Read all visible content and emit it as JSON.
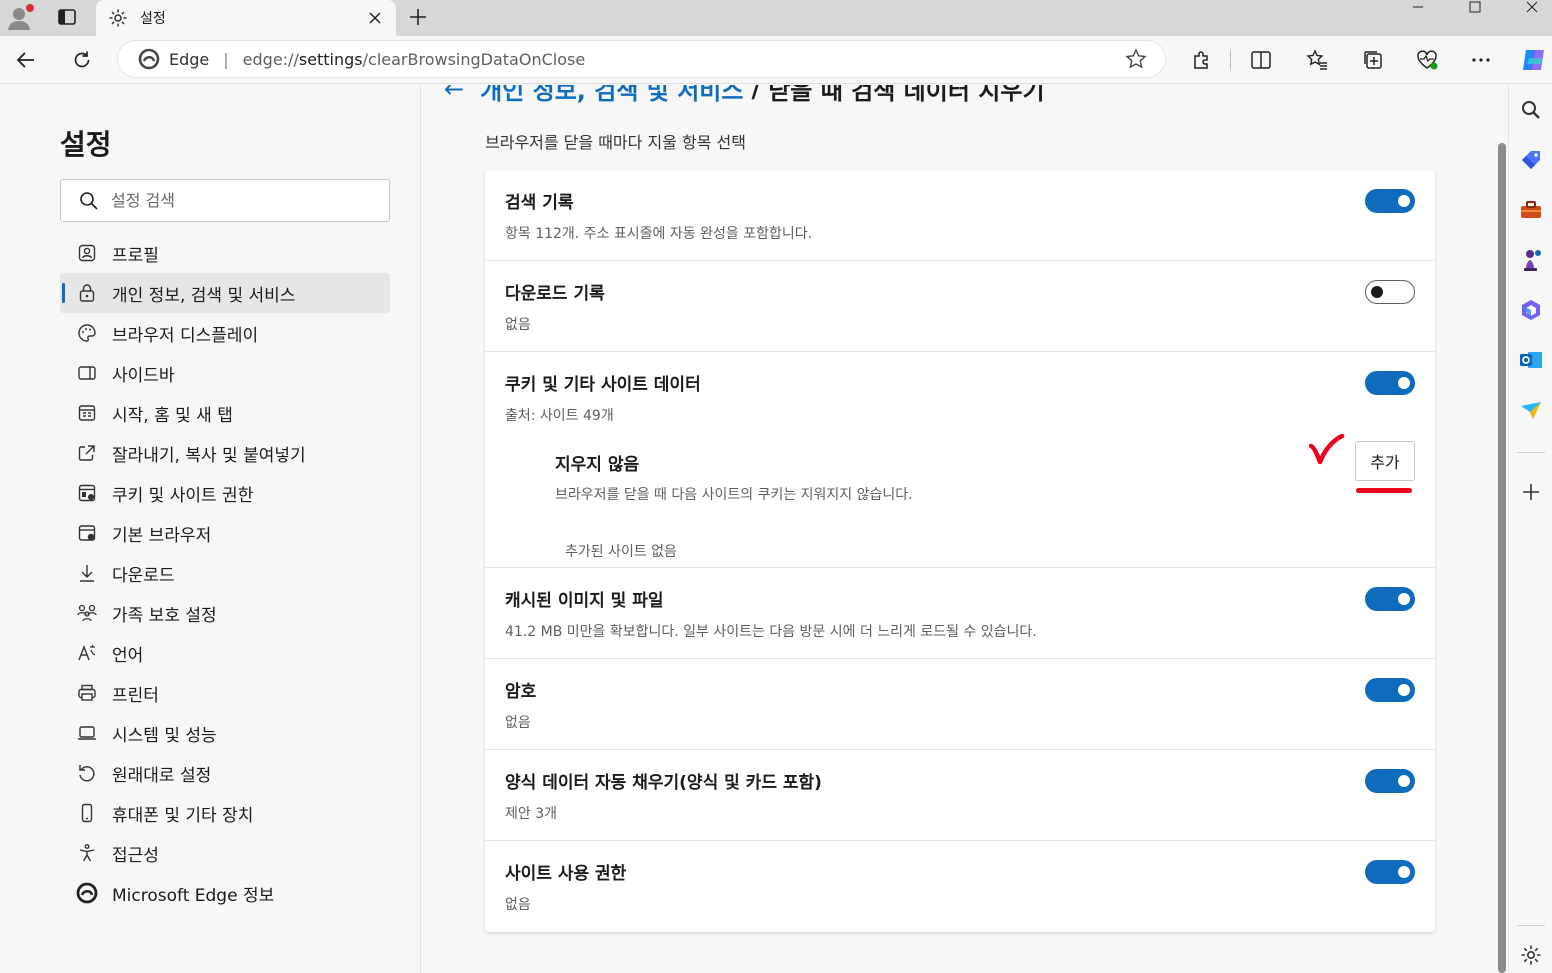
{
  "tab": {
    "title": "설정"
  },
  "address": {
    "brand": "Edge",
    "separator": "|",
    "url_scheme": "edge://",
    "url_host": "settings",
    "url_path": "/clearBrowsingDataOnClose"
  },
  "nav": {
    "title": "설정",
    "search_placeholder": "설정 검색",
    "items": [
      {
        "label": "프로필",
        "icon": "profile-icon"
      },
      {
        "label": "개인 정보, 검색 및 서비스",
        "icon": "lock-icon",
        "active": true
      },
      {
        "label": "브라우저 디스플레이",
        "icon": "palette-icon"
      },
      {
        "label": "사이드바",
        "icon": "sidebar-icon"
      },
      {
        "label": "시작, 홈 및 새 탭",
        "icon": "home-tab-icon"
      },
      {
        "label": "잘라내기, 복사 및 붙여넣기",
        "icon": "share-icon"
      },
      {
        "label": "쿠키 및 사이트 권한",
        "icon": "cookie-icon"
      },
      {
        "label": "기본 브라우저",
        "icon": "browser-icon"
      },
      {
        "label": "다운로드",
        "icon": "download-icon"
      },
      {
        "label": "가족 보호 설정",
        "icon": "family-icon"
      },
      {
        "label": "언어",
        "icon": "language-icon"
      },
      {
        "label": "프린터",
        "icon": "printer-icon"
      },
      {
        "label": "시스템 및 성능",
        "icon": "laptop-icon"
      },
      {
        "label": "원래대로 설정",
        "icon": "reset-icon"
      },
      {
        "label": "휴대폰 및 기타 장치",
        "icon": "phone-icon"
      },
      {
        "label": "접근성",
        "icon": "accessibility-icon"
      },
      {
        "label": "Microsoft Edge 정보",
        "icon": "edge-logo-icon"
      }
    ]
  },
  "main": {
    "breadcrumb_parent": "개인 정보, 검색 및 서비스",
    "breadcrumb_separator": "/",
    "breadcrumb_current": "닫을 때 검색 데이터 지우기",
    "subtitle": "브라우저를 닫을 때마다 지울 항목 선택",
    "rows": [
      {
        "label": "검색 기록",
        "desc": "항목 112개. 주소 표시줄에 자동 완성을 포함합니다.",
        "on": true
      },
      {
        "label": "다운로드 기록",
        "desc": "없음",
        "on": false
      },
      {
        "label": "쿠키 및 기타 사이트 데이터",
        "desc": "출처: 사이트 49개",
        "on": true,
        "sub": {
          "label": "지우지 않음",
          "desc": "브라우저를 닫을 때 다음 사이트의 쿠키는 지워지지 않습니다.",
          "button": "추가",
          "empty": "추가된 사이트 없음"
        }
      },
      {
        "label": "캐시된 이미지 및 파일",
        "desc": "41.2 MB 미만을 확보합니다. 일부 사이트는 다음 방문 시에 더 느리게 로드될 수 있습니다.",
        "on": true
      },
      {
        "label": "암호",
        "desc": "없음",
        "on": true
      },
      {
        "label": "양식 데이터 자동 채우기(양식 및 카드 포함)",
        "desc": "제안 3개",
        "on": true
      },
      {
        "label": "사이트 사용 권한",
        "desc": "없음",
        "on": true
      }
    ]
  },
  "colors": {
    "accent": "#0f6cbd",
    "annotation": "#e8001d"
  }
}
